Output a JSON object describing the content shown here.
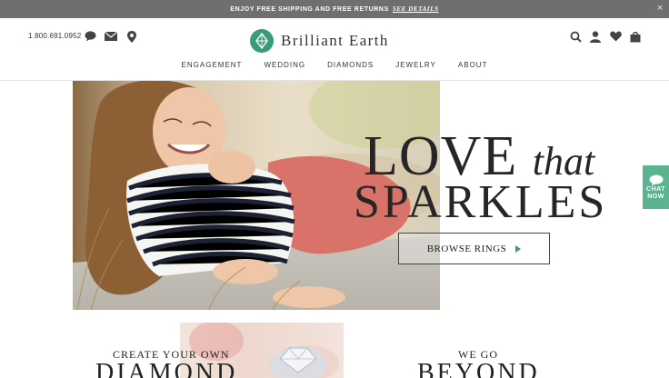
{
  "promo": {
    "text": "ENJOY FREE SHIPPING AND FREE RETURNS",
    "link": "SEE DETAILS",
    "close": "×"
  },
  "header": {
    "phone": "1.800.691.0952",
    "left_icons": [
      "chat-bubble-icon",
      "envelope-icon",
      "location-pin-icon"
    ],
    "right_icons": [
      "search-icon",
      "account-icon",
      "heart-icon",
      "shopping-bag-icon"
    ],
    "brand": "Brilliant Earth",
    "brand_color": "#3a9a7a"
  },
  "nav": {
    "items": [
      "ENGAGEMENT",
      "WEDDING",
      "DIAMONDS",
      "JEWELRY",
      "ABOUT"
    ]
  },
  "hero": {
    "line1_main": "LOVE",
    "line1_script": "that",
    "line2": "SPARKLES",
    "cta": "BROWSE RINGS",
    "cta_arrow_color": "#3a9a7a"
  },
  "chat_tab": {
    "label": "CHAT NOW",
    "color": "#5cb38f"
  },
  "lower": {
    "left_small": "CREATE YOUR OWN",
    "left_big": "DIAMOND",
    "right_small": "WE GO",
    "right_big": "BEYOND"
  }
}
